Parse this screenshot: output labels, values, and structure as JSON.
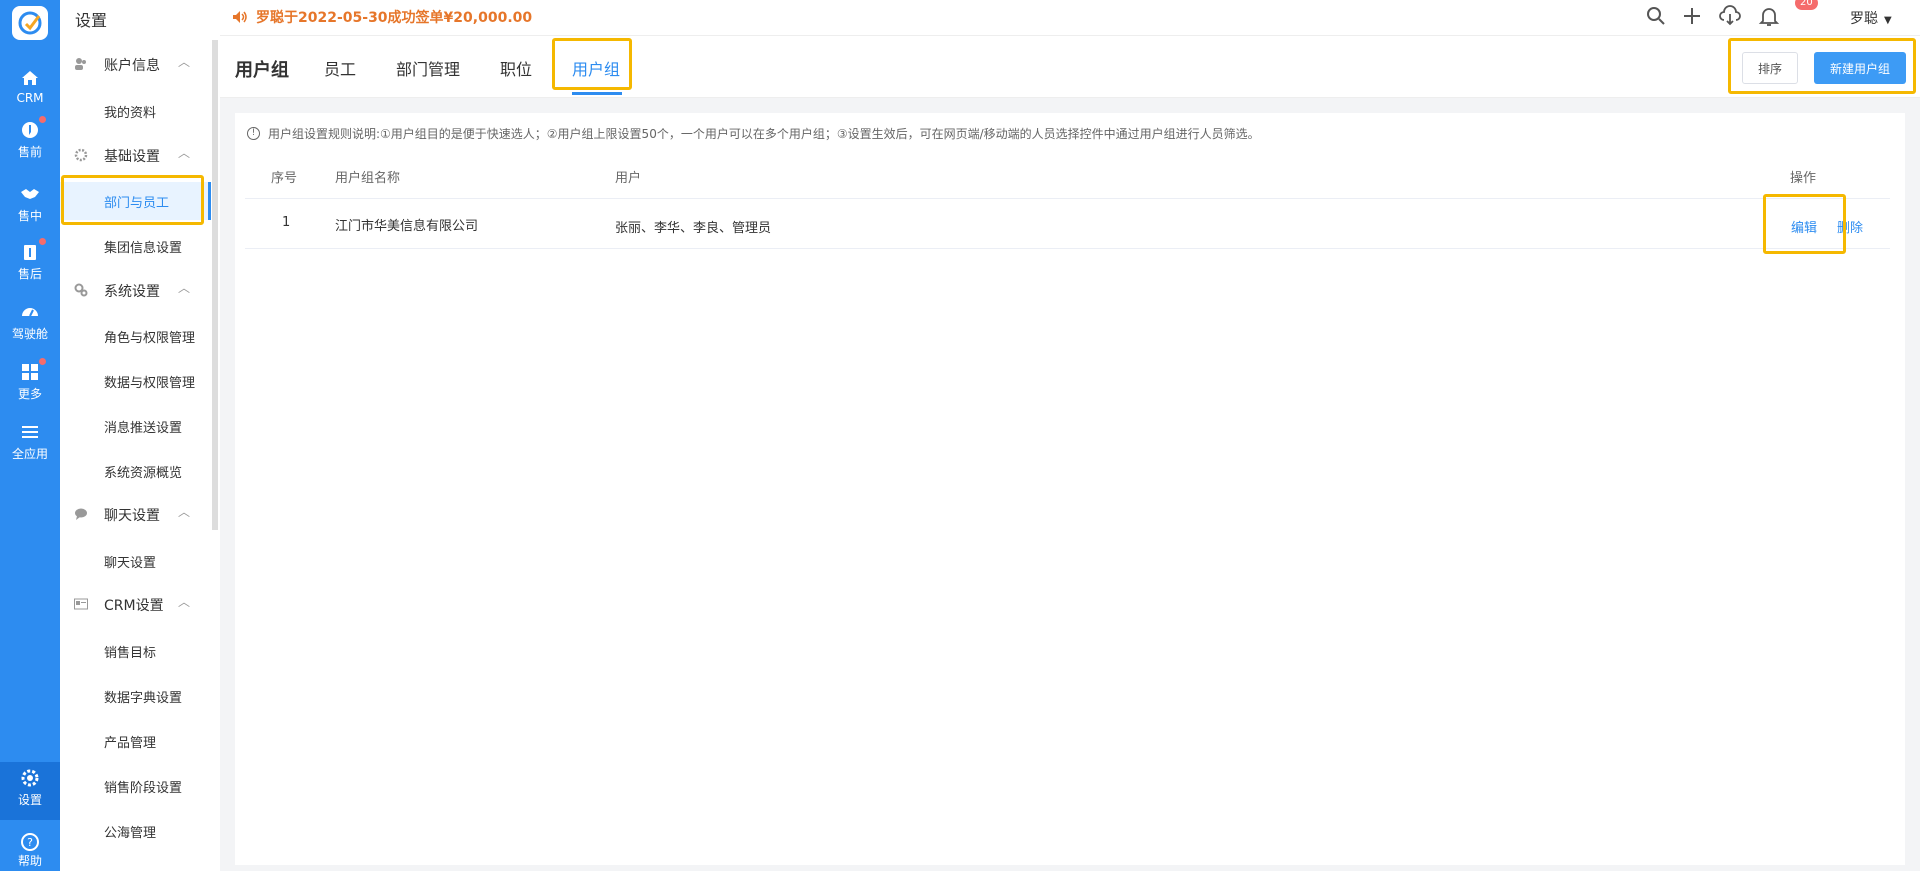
{
  "rail": {
    "items": [
      {
        "label": "CRM",
        "icon": "home-icon"
      },
      {
        "label": "售前",
        "icon": "pin-icon"
      },
      {
        "label": "售中",
        "icon": "handshake-icon"
      },
      {
        "label": "售后",
        "icon": "info-icon"
      },
      {
        "label": "驾驶舱",
        "icon": "dashboard-icon"
      },
      {
        "label": "更多",
        "icon": "grid-icon"
      },
      {
        "label": "全应用",
        "icon": "menu-icon"
      },
      {
        "label": "设置",
        "icon": "gear-icon"
      },
      {
        "label": "帮助",
        "icon": "help-icon"
      }
    ]
  },
  "sidebar": {
    "title": "设置",
    "groups": [
      {
        "label": "账户信息",
        "items": [
          "我的资料"
        ]
      },
      {
        "label": "基础设置",
        "items": [
          "部门与员工",
          "集团信息设置"
        ]
      },
      {
        "label": "系统设置",
        "items": [
          "角色与权限管理",
          "数据与权限管理",
          "消息推送设置",
          "系统资源概览"
        ]
      },
      {
        "label": "聊天设置",
        "items": [
          "聊天设置"
        ]
      },
      {
        "label": "CRM设置",
        "items": [
          "销售目标",
          "数据字典设置",
          "产品管理",
          "销售阶段设置",
          "公海管理"
        ]
      }
    ],
    "active_item": "部门与员工"
  },
  "topbar": {
    "announcement": "罗聪于2022-05-30成功签单¥20,000.00",
    "notification_count": "20",
    "user_name": "罗聪"
  },
  "tabs": {
    "page_title": "用户组",
    "items": [
      "员工",
      "部门管理",
      "职位",
      "用户组"
    ],
    "active": "用户组",
    "sort_button": "排序",
    "new_button": "新建用户组"
  },
  "content": {
    "notice": "用户组设置规则说明:①用户组目的是便于快速选人；②用户组上限设置50个，一个用户可以在多个用户组；③设置生效后，可在网页端/移动端的人员选择控件中通过用户组进行人员筛选。",
    "columns": [
      "序号",
      "用户组名称",
      "用户",
      "操作"
    ],
    "rows": [
      {
        "index": "1",
        "name": "江门市华美信息有限公司",
        "users": "张丽、李华、李良、管理员",
        "edit": "编辑",
        "delete": "删除"
      }
    ]
  },
  "colors": {
    "primary": "#2d8cf0",
    "highlight": "#f5b800",
    "announcement": "#e6762a"
  }
}
